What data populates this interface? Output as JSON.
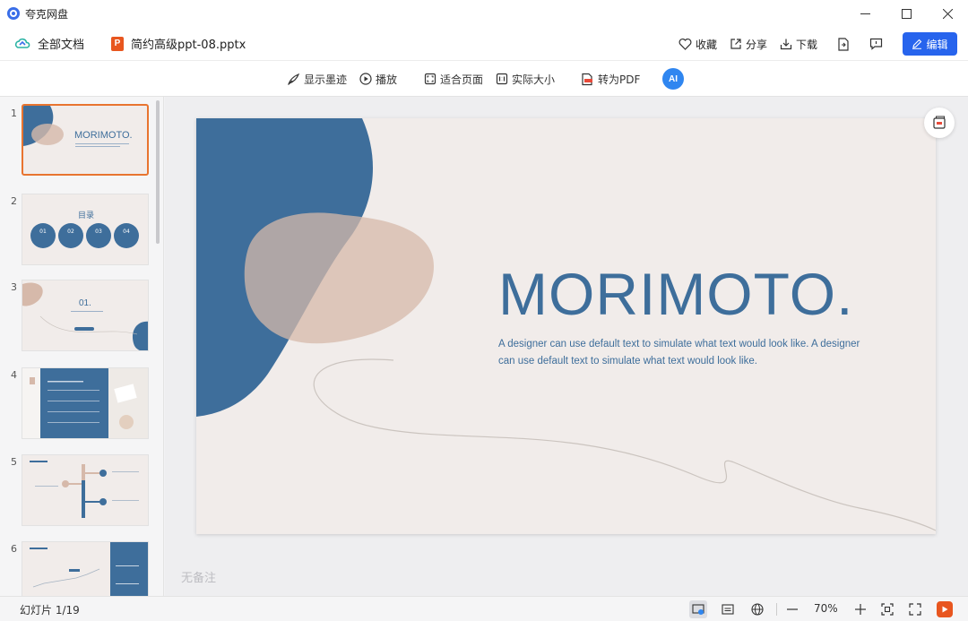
{
  "app": {
    "title": "夸克网盘"
  },
  "window": {
    "minimize": "—",
    "maximize": "☐",
    "close": "✕"
  },
  "header": {
    "all_docs": "全部文档",
    "file_icon_letter": "P",
    "file_name": "简约高级ppt-08.pptx",
    "favorite": "收藏",
    "share": "分享",
    "download": "下载",
    "edit": "编辑"
  },
  "toolbar": {
    "show_ink": "显示墨迹",
    "play": "播放",
    "fit_page": "适合页面",
    "actual_size": "实际大小",
    "to_pdf": "转为PDF",
    "ai_label": "AI"
  },
  "sidebar": {
    "slides": [
      {
        "num": "1",
        "title": "MORIMOTO."
      },
      {
        "num": "2",
        "title": "目录",
        "items": [
          "01",
          "02",
          "03",
          "04"
        ]
      },
      {
        "num": "3",
        "title": "01."
      },
      {
        "num": "4"
      },
      {
        "num": "5"
      },
      {
        "num": "6"
      }
    ]
  },
  "slide": {
    "title": "MORIMOTO.",
    "subtitle": "A designer can use default text to simulate what text would look like. A designer can use default text to simulate what text would look like.",
    "colors": {
      "blue": "#3e6e9b",
      "beige": "#d6b9aa",
      "bg": "#f1ecea"
    }
  },
  "notes": {
    "placeholder": "无备注"
  },
  "status": {
    "slide_count": "幻灯片 1/19",
    "zoom": "70%"
  },
  "colors": {
    "accent": "#2764ed",
    "ppt_orange": "#e8561f",
    "active_border": "#e8742f"
  }
}
